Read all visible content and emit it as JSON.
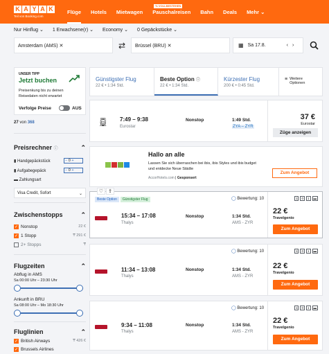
{
  "header": {
    "logo": "KAYAK",
    "logo_letters": [
      "K",
      "A",
      "Y",
      "A",
      "K"
    ],
    "logo_sub": "Teil von Booking.com",
    "nav": [
      {
        "label": "Flüge",
        "active": true
      },
      {
        "label": "Hotels"
      },
      {
        "label": "Mietwagen"
      },
      {
        "label": "Pauschalreisen",
        "tag": "% VOLLBESTEHEN"
      },
      {
        "label": "Bahn"
      },
      {
        "label": "Deals"
      },
      {
        "label": "Mehr ⌄"
      }
    ]
  },
  "filters": {
    "trip": "Nur Hinflug ⌄",
    "travelers": "1 Erwachsene(r) ⌄",
    "cabin": "Economy ⌄",
    "bags": "0 Gepäckstücke ⌄"
  },
  "search": {
    "from": "Amsterdam (AMS) ✕",
    "to": "Brüssel (BRU) ✕",
    "date": "Sa 17.8."
  },
  "sidebar": {
    "tip_label": "UNSER TIPP",
    "tip_title": "Jetzt buchen",
    "tip_text": "Preisenkung bis zu deinen Reisedaten nicht erwartet",
    "track_label": "Verfolge Preise",
    "track_state": "AUS",
    "count_prefix": "27",
    "count_mid": "von",
    "count_total": "368",
    "calc_title": "Preisrechner",
    "bag1": "Handgepäckstück",
    "bag1_val": "0",
    "bag2": "Aufgabegepäck",
    "bag2_val": "0",
    "payment": "Zahlungsart",
    "payment_select": "Visa Credit, Sofort",
    "stops_title": "Zwischenstopps",
    "stops": [
      {
        "label": "Nonstop",
        "price": "22 €",
        "checked": true
      },
      {
        "label": "1 Stopp",
        "price": "₸ 291 €",
        "checked": true
      },
      {
        "label": "2+ Stopps",
        "price": "",
        "checked": false
      }
    ],
    "times_title": "Flugzeiten",
    "dep_label": "Abflug in AMS",
    "dep_range": "Sa 00:00 Uhr – 23:30 Uhr",
    "arr_label": "Ankunft in BRU",
    "arr_range": "Sa 08:00 Uhr – Mo 18:30 Uhr",
    "airlines_title": "Fluglinien",
    "airlines": [
      {
        "label": "British Airways",
        "price": "₸ 426 €"
      },
      {
        "label": "Brussels Airlines",
        "price": ""
      }
    ]
  },
  "sort": [
    {
      "title": "Günstigster Flug",
      "sub": "22 € • 1:34 Std."
    },
    {
      "title": "Beste Option",
      "sub": "22 € • 1:34 Std.",
      "active": true
    },
    {
      "title": "Kürzester Flug",
      "sub": "200 € • 0:45 Std."
    },
    {
      "title": "Weitere Optionen",
      "sub": ""
    }
  ],
  "results": [
    {
      "time": "7:49 – 9:38",
      "carrier": "Eurostar",
      "stops": "Nonstop",
      "duration": "1:49 Std.",
      "route": "ZYA – ZYR",
      "price": "37 €",
      "price_sub": "Eurostar",
      "button": "Züge anzeigen"
    },
    {
      "time": "15:34 – 17:08",
      "carrier": "Thalys",
      "stops": "Nonstop",
      "duration": "1:34 Std.",
      "route": "AMS - ZYR",
      "price": "22 €",
      "price_sub": "Travelgenio",
      "button": "Zum Angebot",
      "rating": "Bewertung: 10",
      "tag1": "Beste Option",
      "tag2": "Günstigster Flug"
    },
    {
      "time": "11:34 – 13:08",
      "carrier": "Thalys",
      "stops": "Nonstop",
      "duration": "1:34 Std.",
      "route": "AMS - ZYR",
      "price": "22 €",
      "price_sub": "Travelgenio",
      "button": "Zum Angebot",
      "rating": "Bewertung: 10"
    },
    {
      "time": "9:34 – 11:08",
      "carrier": "Thalys",
      "stops": "Nonstop",
      "duration": "1:34 Std.",
      "route": "AMS - ZYR",
      "price": "22 €",
      "price_sub": "Travelgenio",
      "button": "Zum Angebot",
      "rating": "Bewertung: 10"
    }
  ],
  "bag_icons": [
    "1",
    "0",
    "1"
  ],
  "ad": {
    "title": "Hallo an alle",
    "text": "Lassen Sie sich überraschen bei ibis, ibis Styles und ibis budget und entdecke Neue Städte",
    "source": "AccorHotels.com",
    "sponsored": "Gesponsert",
    "button": "Zum Angebot"
  },
  "colors": {
    "brand": "#ff690f",
    "link": "#3d6fb4"
  }
}
